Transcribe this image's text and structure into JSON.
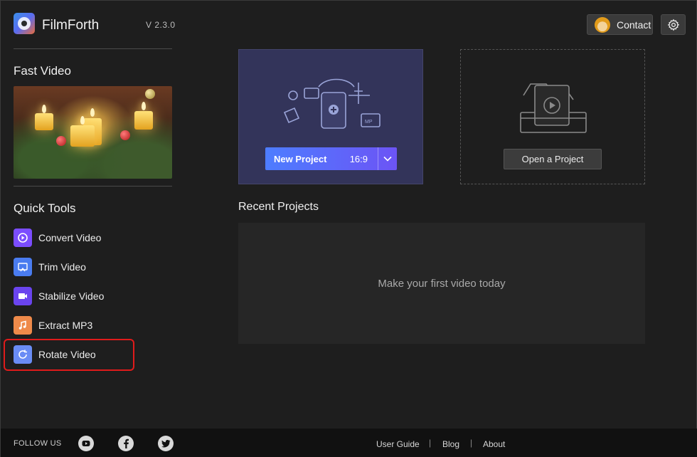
{
  "app": {
    "name": "FilmForth",
    "version": "V  2.3.0"
  },
  "header": {
    "contact_label": "Contact"
  },
  "sidebar": {
    "fast_video_title": "Fast Video",
    "quick_tools_title": "Quick Tools",
    "tools": [
      {
        "label": "Convert Video",
        "icon": "convert-video-icon",
        "color": "#7b4dff"
      },
      {
        "label": "Trim Video",
        "icon": "trim-video-icon",
        "color": "#4a7cf0"
      },
      {
        "label": "Stabilize Video",
        "icon": "stabilize-video-icon",
        "color": "#6a44ee"
      },
      {
        "label": "Extract MP3",
        "icon": "extract-mp3-icon",
        "color": "#ef8a4a"
      },
      {
        "label": "Rotate Video",
        "icon": "rotate-video-icon",
        "color": "#6a8cf5"
      }
    ]
  },
  "main": {
    "new_project": {
      "label": "New Project",
      "ratio": "16:9"
    },
    "open_project_label": "Open a Project",
    "recent_title": "Recent Projects",
    "recent_empty": "Make your first video today"
  },
  "footer": {
    "follow_us": "FOLLOW US",
    "links": [
      "User Guide",
      "Blog",
      "About"
    ]
  },
  "colors": {
    "accent_start": "#4d7dff",
    "accent_end": "#6c54f5",
    "highlight": "#e01b1b"
  }
}
